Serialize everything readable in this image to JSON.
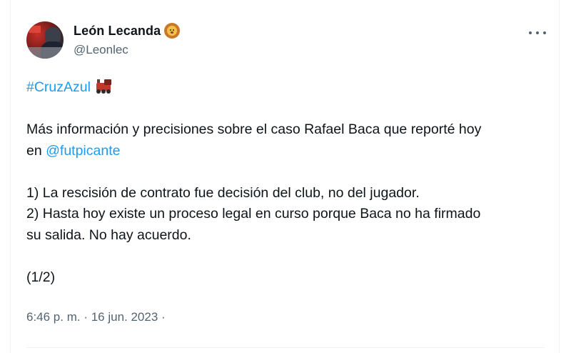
{
  "author": {
    "display_name": "León Lecanda",
    "handle": "@Leonlec",
    "name_emoji": "lion-face-icon"
  },
  "tweet": {
    "hashtag": "#CruzAzul",
    "hashtag_emoji": "steam-locomotive-icon",
    "line1": "Más información y precisiones sobre el caso Rafael Baca que reporté hoy",
    "line2_prefix": "en ",
    "mention": "@futpicante",
    "point1": "1) La rescisión de contrato fue decisión del club, no del jugador.",
    "point2_a": "2) Hasta hoy existe un proceso legal en curso porque Baca no ha firmado",
    "point2_b": "su salida. No hay acuerdo.",
    "thread_marker": "(1/2)"
  },
  "meta": {
    "timestamp": "6:46 p. m. · 16 jun. 2023 ·"
  },
  "colors": {
    "link": "#1d9bf0",
    "text": "#0f1419",
    "secondary": "#536471"
  }
}
